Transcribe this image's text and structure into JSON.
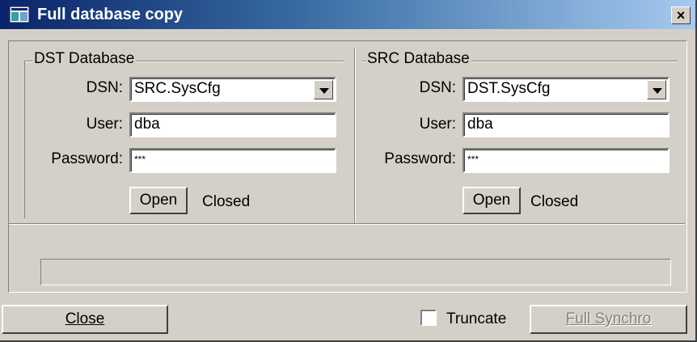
{
  "window": {
    "title": "Full database copy",
    "close_glyph": "×"
  },
  "dst": {
    "legend": "DST Database",
    "dsn_label": "DSN:",
    "dsn_value": "SRC.SysCfg",
    "user_label": "User:",
    "user_value": "dba",
    "password_label": "Password:",
    "password_value": "***",
    "open_label": "Open",
    "status": "Closed"
  },
  "src": {
    "legend": "SRC Database",
    "dsn_label": "DSN:",
    "dsn_value": "DST.SysCfg",
    "user_label": "User:",
    "user_value": "dba",
    "password_label": "Password:",
    "password_value": "***",
    "open_label": "Open",
    "status": "Closed"
  },
  "progress": {
    "value": 0
  },
  "footer": {
    "close_label": "Close",
    "truncate_label": "Truncate",
    "truncate_checked": false,
    "full_synchro_label": "Full Synchro"
  },
  "colors": {
    "title_start": "#0a246a",
    "title_end": "#a6caf0",
    "face": "#d4d0c8"
  }
}
